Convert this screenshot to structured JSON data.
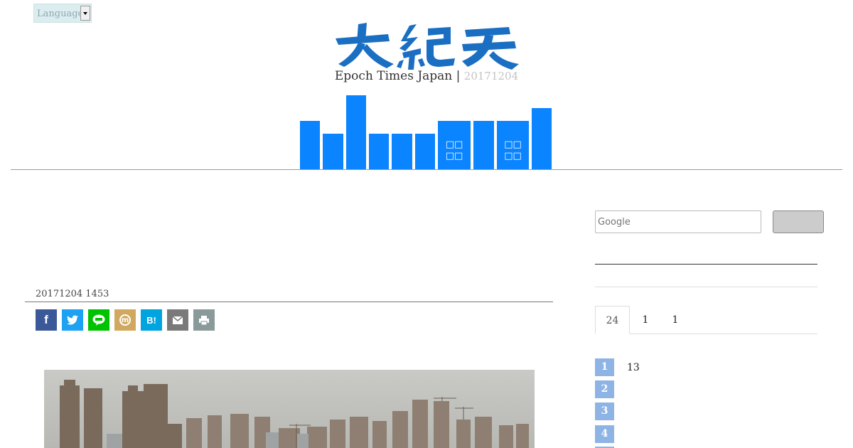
{
  "language_select": {
    "label": "Language"
  },
  "header": {
    "site_name": "Epoch Times Japan |",
    "date": "20171204"
  },
  "nav": {
    "items": [
      {
        "label": "",
        "value": 0.65
      },
      {
        "label": "",
        "value": 0.48
      },
      {
        "label": "",
        "value": 1.0
      },
      {
        "label": "",
        "value": 0.48
      },
      {
        "label": "",
        "value": 0.48
      },
      {
        "label": "",
        "value": 0.48
      },
      {
        "label": "□□ □□",
        "value": 0.65
      },
      {
        "label": "",
        "value": 0.65
      },
      {
        "label": "□□ □□",
        "value": 0.65
      },
      {
        "label": "",
        "value": 0.83
      }
    ]
  },
  "article": {
    "date": "20171204 1453"
  },
  "share": {
    "facebook": "f",
    "twitter": "twitter-bird",
    "line": "LINE",
    "mixi": "m",
    "hatena": "B!",
    "email": "envelope",
    "print": "printer"
  },
  "search": {
    "placeholder": "Google",
    "button_label": ""
  },
  "ranking": {
    "tabs": [
      "24",
      "1",
      "1"
    ],
    "items": [
      {
        "rank": "1",
        "text": "13"
      },
      {
        "rank": "2",
        "text": ""
      },
      {
        "rank": "3",
        "text": ""
      },
      {
        "rank": "4",
        "text": ""
      }
    ]
  },
  "colors": {
    "nav_blue": "#0a84ff",
    "logo_blue": "#1a6fc2",
    "rank_blue": "#8eb4e6"
  }
}
